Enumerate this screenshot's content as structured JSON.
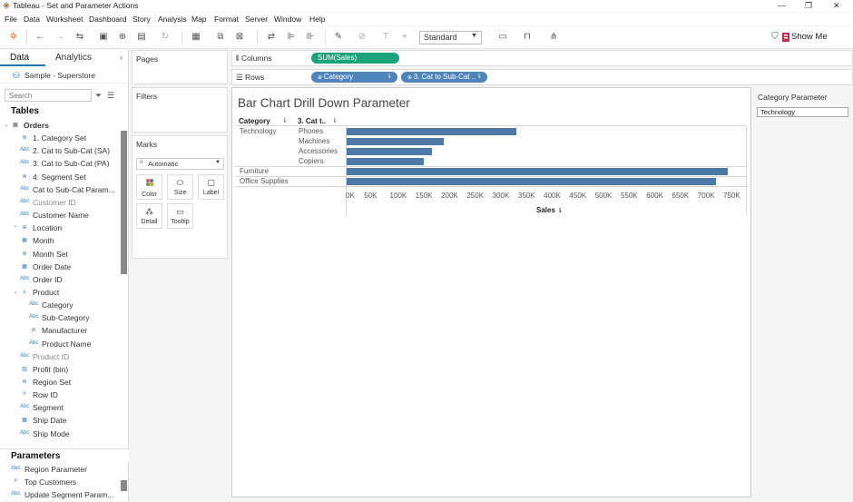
{
  "window": {
    "title": "Tableau - Set and Parameter Actions",
    "min": "—",
    "max": "❐",
    "close": "✕"
  },
  "menu": [
    "File",
    "Data",
    "Worksheet",
    "Dashboard",
    "Story",
    "Analysis",
    "Map",
    "Format",
    "Server",
    "Window",
    "Help"
  ],
  "toolbar": {
    "fit_select": "Standard",
    "show_me": "Show Me"
  },
  "data_pane": {
    "tabs": [
      "Data",
      "Analytics"
    ],
    "datasource": "Sample - Superstore",
    "search_placeholder": "Search",
    "tables_header": "Tables",
    "fields": [
      {
        "label": "Orders",
        "type": "table",
        "indent": 0
      },
      {
        "label": "1. Category Set",
        "type": "set",
        "indent": 1
      },
      {
        "label": "2. Cat to Sub-Cat (SA)",
        "type": "abc",
        "indent": 1
      },
      {
        "label": "3. Cat to Sub-Cat (PA)",
        "type": "abc",
        "indent": 1
      },
      {
        "label": "4. Segment Set",
        "type": "set",
        "indent": 1
      },
      {
        "label": "Cat to Sub-Cat Param...",
        "type": "abc",
        "indent": 1
      },
      {
        "label": "Customer ID",
        "type": "abc",
        "indent": 1,
        "dim": true
      },
      {
        "label": "Customer Name",
        "type": "abc",
        "indent": 1
      },
      {
        "label": "Location",
        "type": "geo",
        "indent": 1
      },
      {
        "label": "Month",
        "type": "date",
        "indent": 1
      },
      {
        "label": "Month Set",
        "type": "set",
        "indent": 1
      },
      {
        "label": "Order Date",
        "type": "date",
        "indent": 1
      },
      {
        "label": "Order ID",
        "type": "abc",
        "indent": 1
      },
      {
        "label": "Product",
        "type": "hier",
        "indent": 1
      },
      {
        "label": "Category",
        "type": "abc",
        "indent": 2
      },
      {
        "label": "Sub-Category",
        "type": "abc",
        "indent": 2
      },
      {
        "label": "Manufacturer",
        "type": "clip",
        "indent": 2
      },
      {
        "label": "Product Name",
        "type": "abc",
        "indent": 2
      },
      {
        "label": "Product ID",
        "type": "abc",
        "indent": 1,
        "dim": true
      },
      {
        "label": "Profit (bin)",
        "type": "bin",
        "indent": 1
      },
      {
        "label": "Region Set",
        "type": "set",
        "indent": 1
      },
      {
        "label": "Row ID",
        "type": "num",
        "indent": 1
      },
      {
        "label": "Segment",
        "type": "abc",
        "indent": 1
      },
      {
        "label": "Ship Date",
        "type": "date",
        "indent": 1
      },
      {
        "label": "Ship Mode",
        "type": "abc",
        "indent": 1
      }
    ],
    "parameters_header": "Parameters",
    "parameters": [
      {
        "label": "Region Parameter",
        "type": "abc"
      },
      {
        "label": "Top Customers",
        "type": "num"
      },
      {
        "label": "Update Segment Param...",
        "type": "abc"
      }
    ]
  },
  "cards": {
    "pages": "Pages",
    "filters": "Filters",
    "marks": "Marks",
    "mark_type": "Automatic",
    "mark_buttons": [
      {
        "label": "Color",
        "icon": "color-icon"
      },
      {
        "label": "Size",
        "icon": "size-icon"
      },
      {
        "label": "Label",
        "icon": "label-icon"
      },
      {
        "label": "Detail",
        "icon": "detail-icon"
      },
      {
        "label": "Tooltip",
        "icon": "tooltip-icon"
      }
    ]
  },
  "shelves": {
    "columns_label": "Columns",
    "rows_label": "Rows",
    "columns_pills": [
      "SUM(Sales)"
    ],
    "rows_pills": [
      "Category",
      "3. Cat to Sub-Cat .."
    ]
  },
  "view": {
    "title": "Bar Chart Drill Down Parameter",
    "col_headers": [
      "Category",
      "3. Cat t.."
    ],
    "axis_title": "Sales"
  },
  "parameter_control": {
    "title": "Category Parameter",
    "value": "Technology"
  },
  "chart_data": {
    "type": "bar",
    "orientation": "horizontal",
    "rows": [
      {
        "category": "Technology",
        "subcategory": "Phones",
        "value": 330000
      },
      {
        "category": "Technology",
        "subcategory": "Machines",
        "value": 189000
      },
      {
        "category": "Technology",
        "subcategory": "Accessories",
        "value": 167000
      },
      {
        "category": "Technology",
        "subcategory": "Copiers",
        "value": 150000
      },
      {
        "category": "Furniture",
        "subcategory": "",
        "value": 742000
      },
      {
        "category": "Office Supplies",
        "subcategory": "",
        "value": 719000
      }
    ],
    "x_ticks": [
      "0K",
      "50K",
      "100K",
      "150K",
      "200K",
      "250K",
      "300K",
      "350K",
      "400K",
      "450K",
      "500K",
      "550K",
      "600K",
      "650K",
      "700K",
      "750K"
    ],
    "xlabel": "Sales",
    "xlim": [
      0,
      780000
    ],
    "color": "#4e79a7"
  }
}
